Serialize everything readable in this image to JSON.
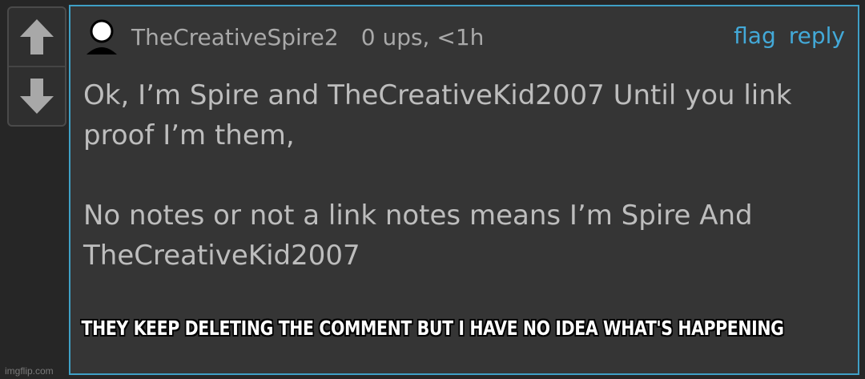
{
  "vote": {
    "up_icon": "arrow-up-icon",
    "down_icon": "arrow-down-icon"
  },
  "comment": {
    "avatar_icon": "user-avatar-icon",
    "username": "TheCreativeSpire2",
    "meta": "0 ups, <1h",
    "flag_label": "flag",
    "reply_label": "reply",
    "paragraph_1": "Ok, I’m Spire and TheCreativeKid2007 Until you link proof I’m them,",
    "paragraph_2": "No notes or not a link notes means I’m Spire And TheCreativeKid2007"
  },
  "caption": "THEY KEEP DELETING THE COMMENT BUT I HAVE NO IDEA WHAT'S HAPPENING",
  "watermark": "imgflip.com",
  "colors": {
    "background": "#262626",
    "comment_bg": "#353535",
    "accent": "#43a9d8",
    "border": "#3fa0c6",
    "text": "#bdbdbd",
    "muted": "#a9a9a9"
  }
}
